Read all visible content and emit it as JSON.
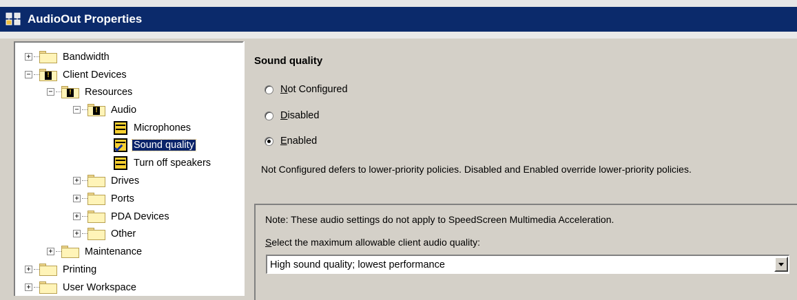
{
  "window": {
    "title": "AudioOut Properties"
  },
  "tree": {
    "items": [
      {
        "label": "Bandwidth",
        "level": 0,
        "expander": "+",
        "icon": "folder-icon"
      },
      {
        "label": "Client Devices",
        "level": 0,
        "expander": "-",
        "icon": "folder-warning-icon"
      },
      {
        "label": "Resources",
        "level": 1,
        "expander": "-",
        "icon": "folder-warning-icon"
      },
      {
        "label": "Audio",
        "level": 2,
        "expander": "-",
        "icon": "folder-warning-icon"
      },
      {
        "label": "Microphones",
        "level": 3,
        "icon": "setting-icon"
      },
      {
        "label": "Sound quality",
        "level": 3,
        "icon": "setting-checked-icon",
        "selected": true
      },
      {
        "label": "Turn off speakers",
        "level": 3,
        "icon": "setting-icon"
      },
      {
        "label": "Drives",
        "level": 2,
        "expander": "+",
        "icon": "folder-icon"
      },
      {
        "label": "Ports",
        "level": 2,
        "expander": "+",
        "icon": "folder-icon"
      },
      {
        "label": "PDA Devices",
        "level": 2,
        "expander": "+",
        "icon": "folder-icon"
      },
      {
        "label": "Other",
        "level": 2,
        "expander": "+",
        "icon": "folder-icon"
      },
      {
        "label": "Maintenance",
        "level": 1,
        "expander": "+",
        "icon": "folder-icon"
      },
      {
        "label": "Printing",
        "level": 0,
        "expander": "+",
        "icon": "folder-icon"
      },
      {
        "label": "User Workspace",
        "level": 0,
        "expander": "+",
        "icon": "folder-icon"
      }
    ]
  },
  "panel": {
    "title": "Sound quality",
    "radios": [
      {
        "label": "Not Configured",
        "mnemonic": "N",
        "rest": "ot Configured",
        "checked": false
      },
      {
        "label": "Disabled",
        "mnemonic": "D",
        "rest": "isabled",
        "checked": false
      },
      {
        "label": "Enabled",
        "mnemonic": "E",
        "rest": "nabled",
        "checked": true
      }
    ],
    "description": "Not Configured defers to lower-priority policies. Disabled and Enabled override lower-priority policies.",
    "note": "Note: These audio settings do not apply to SpeedScreen Multimedia Acceleration.",
    "select_label_mnemonic": "S",
    "select_label_rest": "elect the maximum allowable client audio quality:",
    "dropdown_value": "High sound quality; lowest performance"
  }
}
